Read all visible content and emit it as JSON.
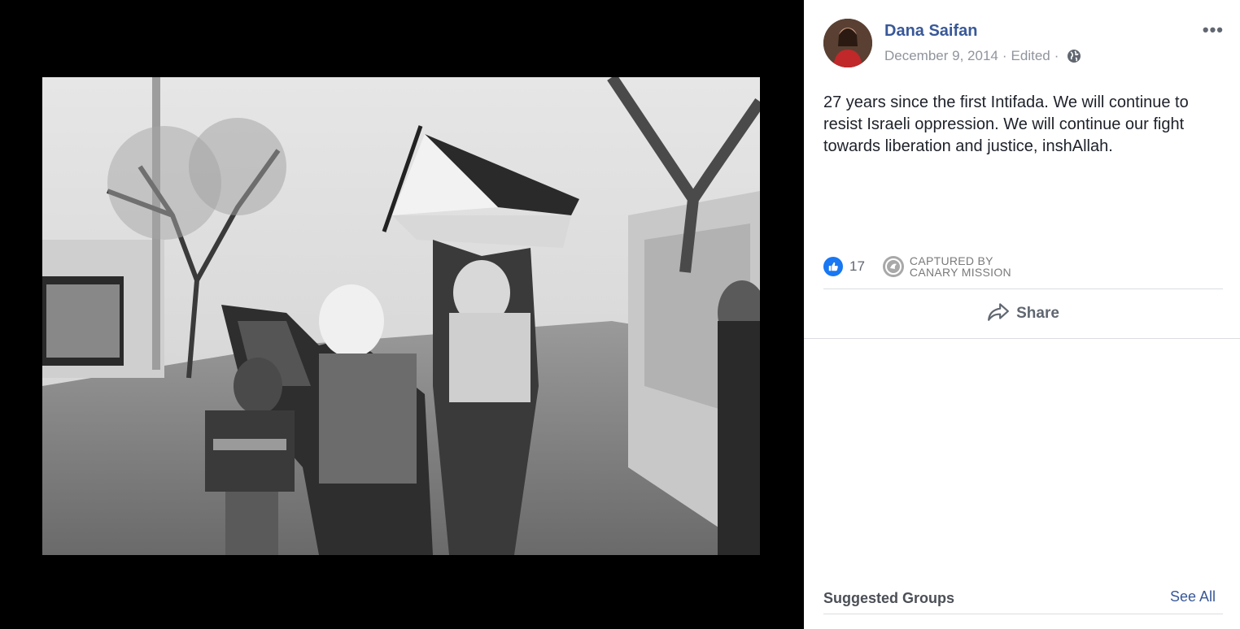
{
  "post": {
    "author": "Dana Saifan",
    "date": "December 9, 2014",
    "edited": "Edited",
    "sep1": "·",
    "sep2": "·",
    "privacy_icon": "globe-icon",
    "more_label": "•••",
    "text": "27 years since the first Intifada. We will continue to resist Israeli oppression. We will continue our fight towards liberation and justice, inshAllah."
  },
  "reactions": {
    "icon": "thumbs-up-icon",
    "count": "17"
  },
  "captured": {
    "line1": "CAPTURED BY",
    "line2": "CANARY MISSION"
  },
  "share": {
    "label": "Share",
    "icon": "share-arrow-icon"
  },
  "suggested_groups": {
    "title": "Suggested Groups",
    "see_all": "See All"
  },
  "colors": {
    "link_blue": "#385898",
    "like_blue": "#1877f2",
    "meta_gray": "#90949c"
  }
}
